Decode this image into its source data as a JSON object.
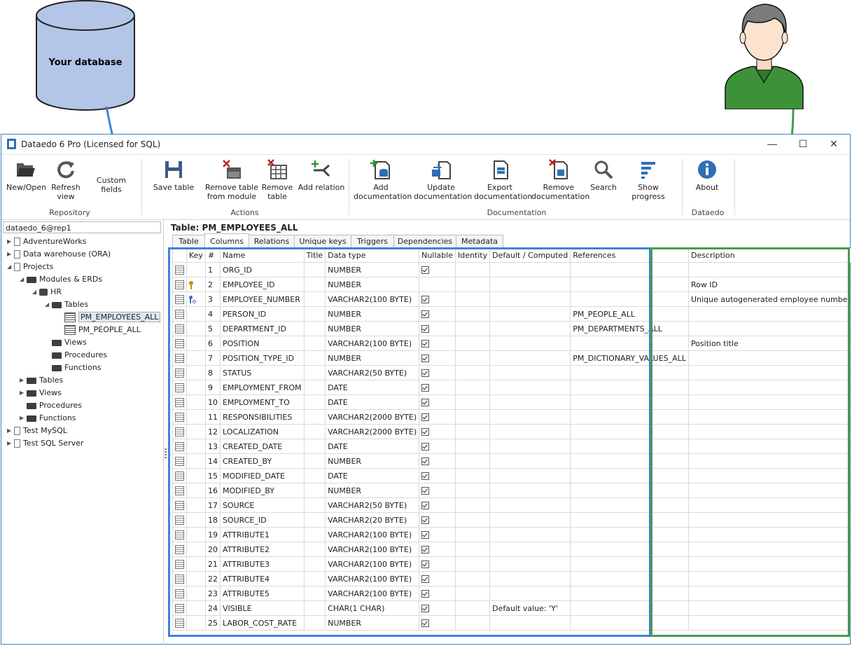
{
  "illustration": {
    "database_label": "Your database"
  },
  "window": {
    "title": "Dataedo 6 Pro (Licensed for SQL)"
  },
  "ribbon": {
    "groups": [
      {
        "label": "Repository",
        "buttons": [
          "New/Open",
          "Refresh view",
          "Custom fields"
        ]
      },
      {
        "label": "Actions",
        "buttons": [
          "Save table",
          "Remove table from module",
          "Remove table",
          "Add relation"
        ]
      },
      {
        "label": "Documentation",
        "buttons": [
          "Add documentation",
          "Update documentation",
          "Export documentation",
          "Remove documentation",
          "Search",
          "Show progress"
        ]
      },
      {
        "label": "Dataedo",
        "buttons": [
          "About"
        ]
      }
    ]
  },
  "sidebar": {
    "repository": "dataedo_6@rep1",
    "tree": [
      "AdventureWorks",
      "Data warehouse (ORA)",
      "Projects",
      "Modules & ERDs",
      "HR",
      "Tables",
      "PM_EMPLOYEES_ALL",
      "PM_PEOPLE_ALL",
      "Views",
      "Procedures",
      "Functions",
      "Tables",
      "Views",
      "Procedures",
      "Functions",
      "Test MySQL",
      "Test SQL Server"
    ]
  },
  "main": {
    "title": "Table: PM_EMPLOYEES_ALL",
    "tabs": [
      "Table",
      "Columns",
      "Relations",
      "Unique keys",
      "Triggers",
      "Dependencies",
      "Metadata"
    ],
    "active_tab": "Columns",
    "columns": [
      "",
      "Key",
      "#",
      "Name",
      "Title",
      "Data type",
      "Nullable",
      "Identity",
      "Default / Computed",
      "References",
      "Description"
    ],
    "rows": [
      {
        "key": "",
        "n": "1",
        "name": "ORG_ID",
        "type": "NUMBER",
        "nullable": true,
        "default": "",
        "ref": "",
        "desc": ""
      },
      {
        "key": "pk",
        "n": "2",
        "name": "EMPLOYEE_ID",
        "type": "NUMBER",
        "nullable": false,
        "default": "",
        "ref": "",
        "desc": "Row ID"
      },
      {
        "key": "uk",
        "n": "3",
        "name": "EMPLOYEE_NUMBER",
        "type": "VARCHAR2(100 BYTE)",
        "nullable": true,
        "default": "",
        "ref": "",
        "desc": "Unique autogenerated employee number"
      },
      {
        "key": "",
        "n": "4",
        "name": "PERSON_ID",
        "type": "NUMBER",
        "nullable": true,
        "default": "",
        "ref": "PM_PEOPLE_ALL",
        "desc": ""
      },
      {
        "key": "",
        "n": "5",
        "name": "DEPARTMENT_ID",
        "type": "NUMBER",
        "nullable": true,
        "default": "",
        "ref": "PM_DEPARTMENTS_ALL",
        "desc": ""
      },
      {
        "key": "",
        "n": "6",
        "name": "POSITION",
        "type": "VARCHAR2(100 BYTE)",
        "nullable": true,
        "default": "",
        "ref": "",
        "desc": "Position title"
      },
      {
        "key": "",
        "n": "7",
        "name": "POSITION_TYPE_ID",
        "type": "NUMBER",
        "nullable": true,
        "default": "",
        "ref": "PM_DICTIONARY_VALUES_ALL",
        "desc": ""
      },
      {
        "key": "",
        "n": "8",
        "name": "STATUS",
        "type": "VARCHAR2(50 BYTE)",
        "nullable": true,
        "default": "",
        "ref": "",
        "desc": ""
      },
      {
        "key": "",
        "n": "9",
        "name": "EMPLOYMENT_FROM",
        "type": "DATE",
        "nullable": true,
        "default": "",
        "ref": "",
        "desc": ""
      },
      {
        "key": "",
        "n": "10",
        "name": "EMPLOYMENT_TO",
        "type": "DATE",
        "nullable": true,
        "default": "",
        "ref": "",
        "desc": ""
      },
      {
        "key": "",
        "n": "11",
        "name": "RESPONSIBILITIES",
        "type": "VARCHAR2(2000 BYTE)",
        "nullable": true,
        "default": "",
        "ref": "",
        "desc": ""
      },
      {
        "key": "",
        "n": "12",
        "name": "LOCALIZATION",
        "type": "VARCHAR2(2000 BYTE)",
        "nullable": true,
        "default": "",
        "ref": "",
        "desc": ""
      },
      {
        "key": "",
        "n": "13",
        "name": "CREATED_DATE",
        "type": "DATE",
        "nullable": true,
        "default": "",
        "ref": "",
        "desc": ""
      },
      {
        "key": "",
        "n": "14",
        "name": "CREATED_BY",
        "type": "NUMBER",
        "nullable": true,
        "default": "",
        "ref": "",
        "desc": ""
      },
      {
        "key": "",
        "n": "15",
        "name": "MODIFIED_DATE",
        "type": "DATE",
        "nullable": true,
        "default": "",
        "ref": "",
        "desc": ""
      },
      {
        "key": "",
        "n": "16",
        "name": "MODIFIED_BY",
        "type": "NUMBER",
        "nullable": true,
        "default": "",
        "ref": "",
        "desc": ""
      },
      {
        "key": "",
        "n": "17",
        "name": "SOURCE",
        "type": "VARCHAR2(50 BYTE)",
        "nullable": true,
        "default": "",
        "ref": "",
        "desc": ""
      },
      {
        "key": "",
        "n": "18",
        "name": "SOURCE_ID",
        "type": "VARCHAR2(20 BYTE)",
        "nullable": true,
        "default": "",
        "ref": "",
        "desc": ""
      },
      {
        "key": "",
        "n": "19",
        "name": "ATTRIBUTE1",
        "type": "VARCHAR2(100 BYTE)",
        "nullable": true,
        "default": "",
        "ref": "",
        "desc": ""
      },
      {
        "key": "",
        "n": "20",
        "name": "ATTRIBUTE2",
        "type": "VARCHAR2(100 BYTE)",
        "nullable": true,
        "default": "",
        "ref": "",
        "desc": ""
      },
      {
        "key": "",
        "n": "21",
        "name": "ATTRIBUTE3",
        "type": "VARCHAR2(100 BYTE)",
        "nullable": true,
        "default": "",
        "ref": "",
        "desc": ""
      },
      {
        "key": "",
        "n": "22",
        "name": "ATTRIBUTE4",
        "type": "VARCHAR2(100 BYTE)",
        "nullable": true,
        "default": "",
        "ref": "",
        "desc": ""
      },
      {
        "key": "",
        "n": "23",
        "name": "ATTRIBUTE5",
        "type": "VARCHAR2(100 BYTE)",
        "nullable": true,
        "default": "",
        "ref": "",
        "desc": ""
      },
      {
        "key": "",
        "n": "24",
        "name": "VISIBLE",
        "type": "CHAR(1 CHAR)",
        "nullable": true,
        "default": "Default value: 'Y'",
        "ref": "",
        "desc": ""
      },
      {
        "key": "",
        "n": "25",
        "name": "LABOR_COST_RATE",
        "type": "NUMBER",
        "nullable": true,
        "default": "",
        "ref": "",
        "desc": ""
      }
    ]
  },
  "colors": {
    "accent_blue": "#3c82e0",
    "accent_green": "#4c9a4a",
    "window_border": "#3c7fc8"
  }
}
